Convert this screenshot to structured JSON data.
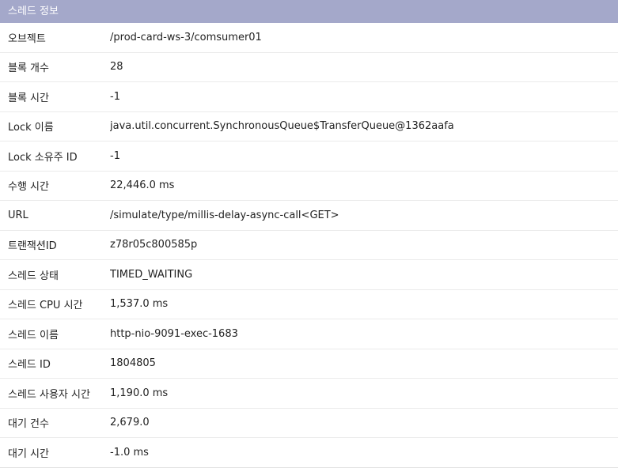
{
  "panel": {
    "title": "스레드 정보"
  },
  "rows": [
    {
      "label": "오브젝트",
      "value": "/prod-card-ws-3/comsumer01"
    },
    {
      "label": "블록 개수",
      "value": "28"
    },
    {
      "label": "블록 시간",
      "value": "-1"
    },
    {
      "label": "Lock 이름",
      "value": "java.util.concurrent.SynchronousQueue$TransferQueue@1362aafa"
    },
    {
      "label": "Lock 소유주 ID",
      "value": "-1"
    },
    {
      "label": "수행 시간",
      "value": "22,446.0 ms"
    },
    {
      "label": "URL",
      "value": "/simulate/type/millis-delay-async-call<GET>"
    },
    {
      "label": "트랜잭션ID",
      "value": "z78r05c800585p"
    },
    {
      "label": "스레드 상태",
      "value": "TIMED_WAITING"
    },
    {
      "label": "스레드 CPU 시간",
      "value": "1,537.0 ms"
    },
    {
      "label": "스레드 이름",
      "value": "http-nio-9091-exec-1683"
    },
    {
      "label": "스레드 ID",
      "value": "1804805"
    },
    {
      "label": "스레드 사용자 시간",
      "value": "1,190.0 ms"
    },
    {
      "label": "대기 건수",
      "value": "2,679.0"
    },
    {
      "label": "대기 시간",
      "value": "-1.0 ms"
    }
  ],
  "colors": {
    "header_bg": "#a4a8ca",
    "header_text": "#ffffff",
    "row_border": "#ebebeb"
  }
}
